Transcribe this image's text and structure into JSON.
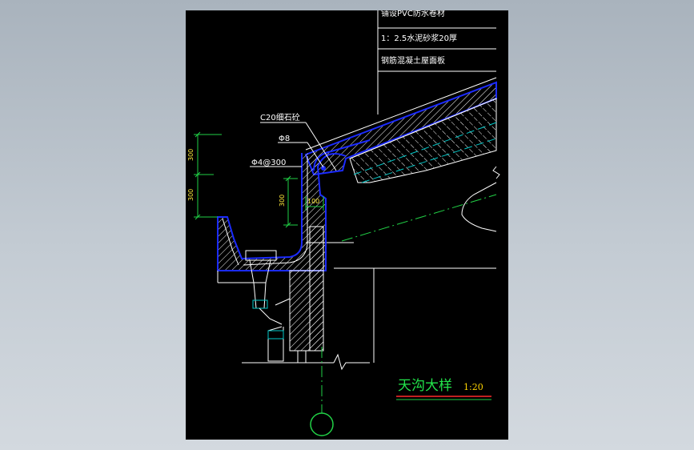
{
  "drawing": {
    "notes": [
      "铺设PVC防水卷材",
      "1：2.5水泥砂浆20厚",
      "钢筋混凝土屋面板"
    ],
    "callouts": {
      "concrete": "C20细石砼",
      "bar": "Φ8",
      "bar_spacing": "Φ4@300"
    },
    "dimensions": {
      "upper": "300",
      "lower": "300",
      "inner": "300",
      "width": "100"
    },
    "title": "天沟大样",
    "scale": "1:20"
  },
  "colors": {
    "background": "#000000",
    "concrete_outline": "#1b2bff",
    "dimension": "#21d146",
    "text": "#ffffff",
    "title": "#22e34a",
    "scale": "#ffd400",
    "centerline": "#21d146",
    "hidden": "#00c8c8"
  }
}
